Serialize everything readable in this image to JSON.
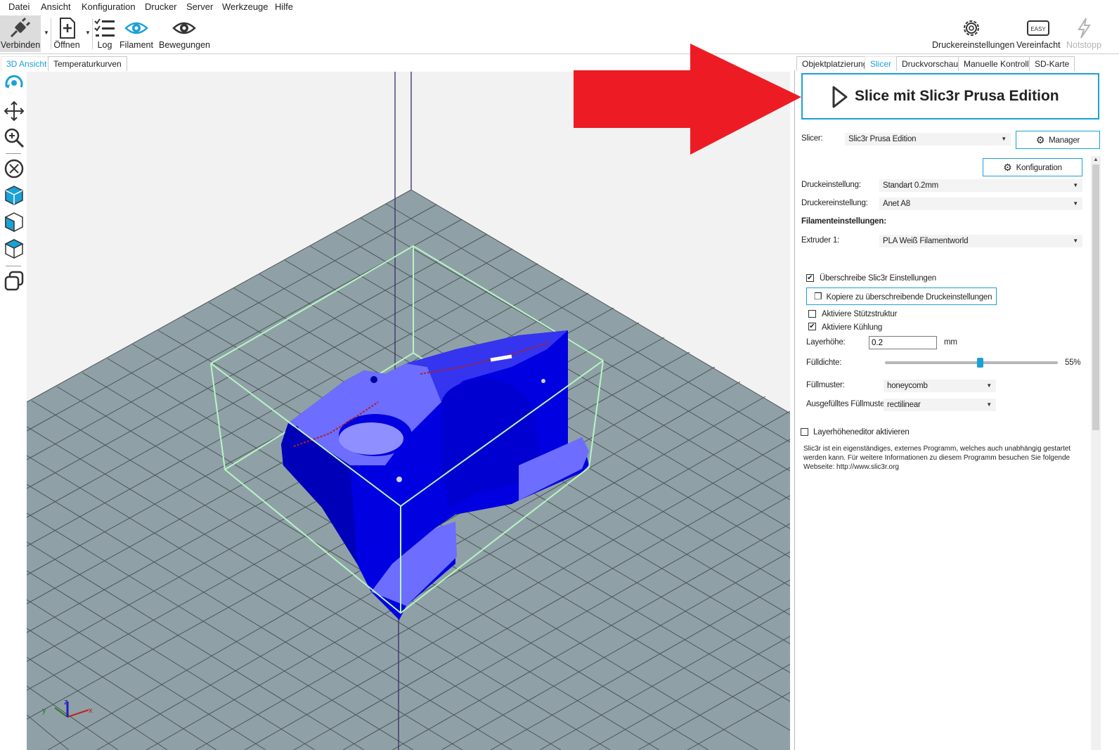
{
  "menu": [
    "Datei",
    "Ansicht",
    "Konfiguration",
    "Drucker",
    "Server",
    "Werkzeuge",
    "Hilfe"
  ],
  "toolbar": {
    "connect": "Verbinden",
    "open": "Öffnen",
    "log": "Log",
    "filament": "Filament",
    "moves": "Bewegungen",
    "printer_settings": "Druckereinstellungen",
    "simplified": "Vereinfacht",
    "emergency": "Notstopp",
    "easy_badge": "EASY"
  },
  "view_tabs": [
    "3D Ansicht",
    "Temperaturkurven"
  ],
  "panel_tabs": [
    "Objektplatzierung",
    "Slicer",
    "Druckvorschau",
    "Manuelle Kontrolle",
    "SD-Karte"
  ],
  "slicer": {
    "slice_button": "Slice mit Slic3r Prusa Edition",
    "slicer_label": "Slicer:",
    "slicer_value": "Slic3r Prusa Edition",
    "manager_button": "Manager",
    "config_button": "Konfiguration",
    "print_setting_label": "Druckeinstellung:",
    "print_setting_value": "Standart 0.2mm",
    "printer_setting_label": "Druckereinstellung:",
    "printer_setting_value": "Anet A8",
    "filament_heading": "Filamenteinstellungen:",
    "extruder_label": "Extruder 1:",
    "extruder_value": "PLA Weiß Filamentworld",
    "override_label": "Überschreibe Slic3r Einstellungen",
    "override_checked": true,
    "copy_button": "Kopiere zu überschreibende Druckeinstellungen",
    "support_label": "Aktiviere Stützstruktur",
    "support_checked": false,
    "cooling_label": "Aktiviere Kühlung",
    "cooling_checked": true,
    "layer_height_label": "Layerhöhe:",
    "layer_height_value": "0.2",
    "layer_height_unit": "mm",
    "infill_label": "Fülldichte:",
    "infill_value": "55%",
    "infill_fraction": 0.55,
    "pattern_label": "Füllmuster:",
    "pattern_value": "honeycomb",
    "solid_pattern_label": "Ausgefülltes Füllmuster:",
    "solid_pattern_value": "rectilinear",
    "layer_editor_label": "Layerhöheneditor aktivieren",
    "layer_editor_checked": false,
    "info_text": "Slic3r ist ein eigenständiges, externes Programm, welches auch unabhängig gestartet werden kann. Für weitere Informationen zu diesem Programm besuchen Sie folgende Webseite: http://www.slic3r.org"
  },
  "colors": {
    "accent": "#1aa1d6",
    "arrow": "#ed1c24",
    "model": "#0000e0",
    "bed": "#8fa1a7",
    "bbox": "#b8f5c4"
  }
}
